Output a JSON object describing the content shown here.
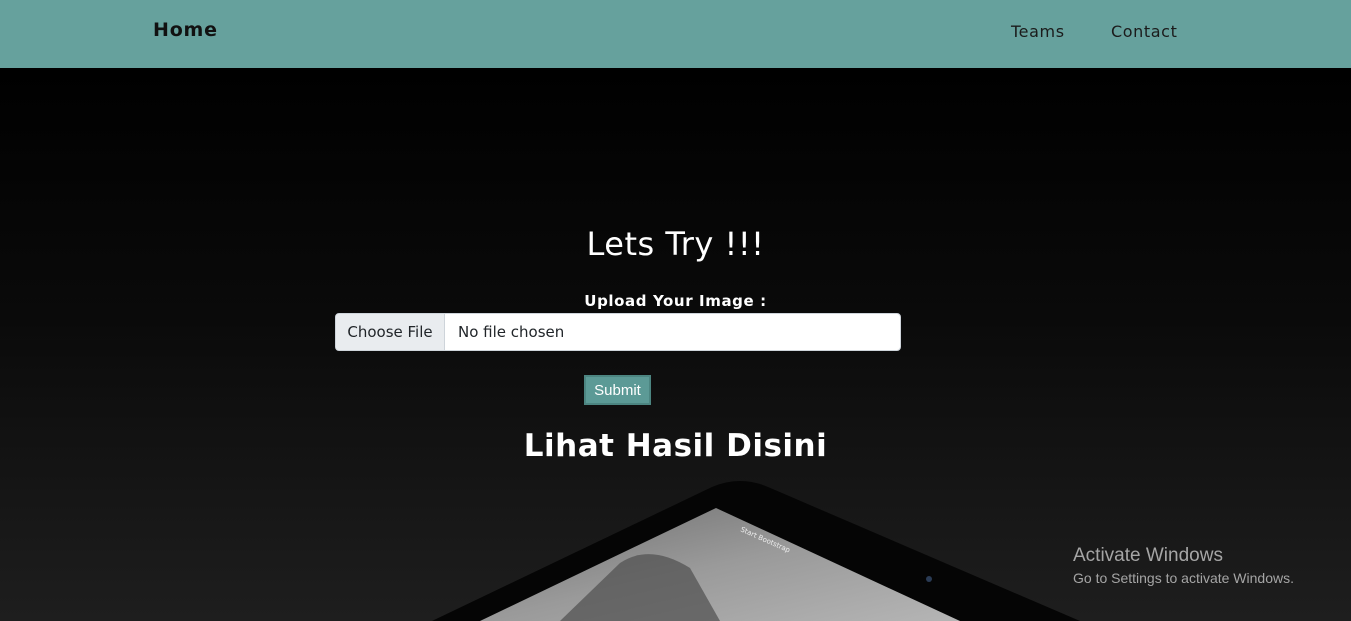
{
  "navbar": {
    "brand": "Home",
    "links": [
      {
        "label": "Teams"
      },
      {
        "label": "Contact"
      }
    ],
    "background": "#66a19d"
  },
  "hero": {
    "title": "Lets Try !!!",
    "upload_label": "Upload Your Image :",
    "file_input": {
      "button_label": "Choose File",
      "status": "No file chosen"
    },
    "submit_label": "Submit",
    "result_title": "Lihat Hasil Disini",
    "tablet_screen_text": "Start Bootstrap"
  },
  "watermark": {
    "title": "Activate Windows",
    "subtitle": "Go to Settings to activate Windows."
  }
}
